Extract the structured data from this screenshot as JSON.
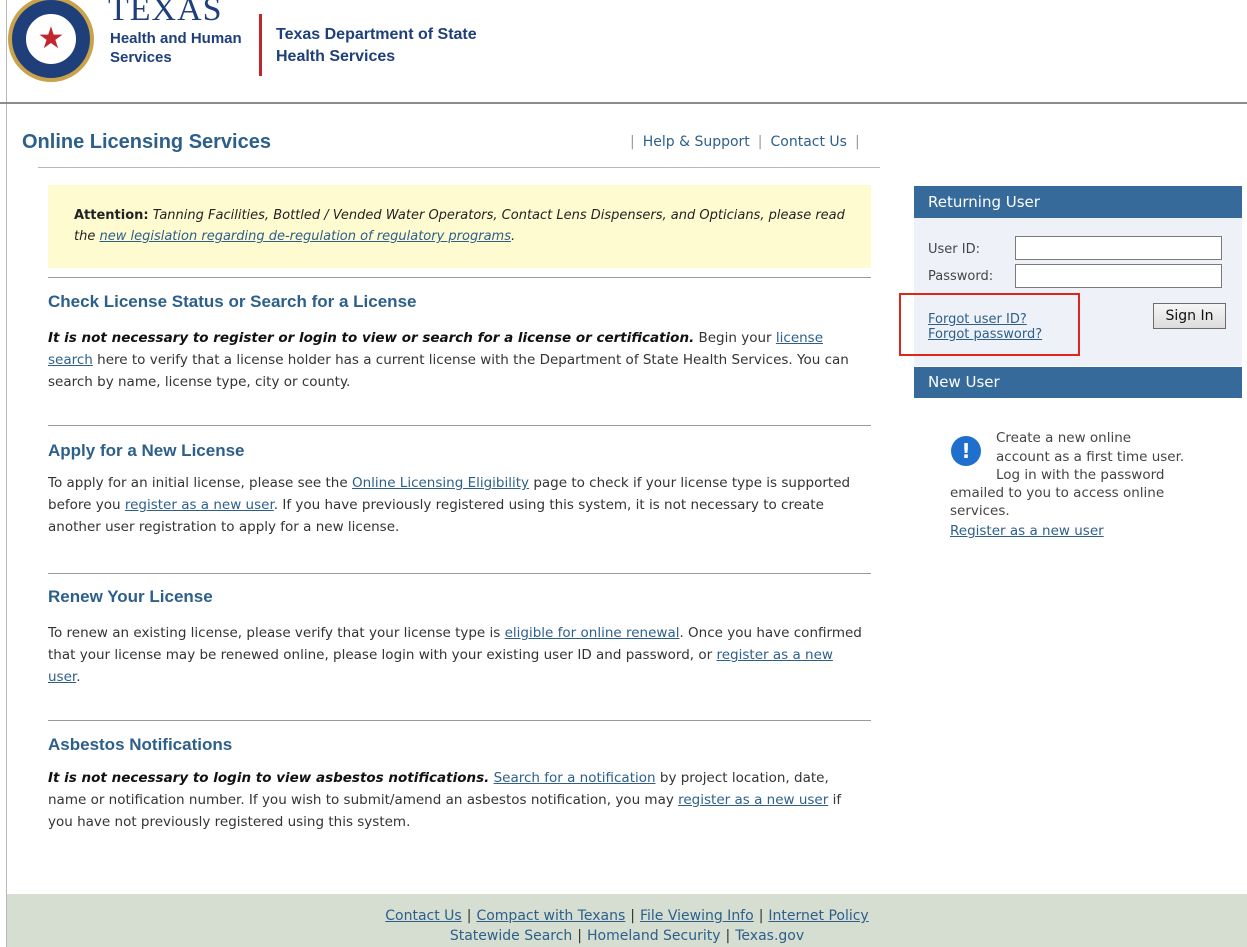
{
  "header": {
    "texas": "TEXAS",
    "hhs_line1": "Health and Human",
    "hhs_line2": "Services",
    "dshs_line1": "Texas Department of State",
    "dshs_line2": "Health Services"
  },
  "title": "Online Licensing Services",
  "top_links": [
    "Help & Support",
    "Contact Us"
  ],
  "attention": {
    "label": "Attention:",
    "text": "Tanning Facilities, Bottled / Vended Water Operators, Contact Lens Dispensers, and Opticians, please read the",
    "link": "new legislation regarding de-regulation of regulatory programs",
    "end": "."
  },
  "sections": {
    "check": {
      "title": "Check License Status or Search for a License",
      "bold": "It is not necessary to register or login to view or search for a license or certification.",
      "t1": " Begin your ",
      "link1": "license search",
      "t2": " here to verify that a license holder has a current license with the Department of State Health Services. You can search by name, license type, city or county."
    },
    "apply": {
      "title": "Apply for a New License",
      "t1": "To apply for an initial license, please see the ",
      "link1": "Online Licensing Eligibility",
      "t2": " page to check if your license type is supported before you ",
      "link2": "register as a new user",
      "t3": ". If you have previously registered using this system, it is not necessary to create another user registration to apply for a new license."
    },
    "renew": {
      "title": "Renew Your License",
      "t1": "To renew an existing license, please verify that your license type is ",
      "link1": "eligible for online renewal",
      "t2": ". Once you have confirmed that your license may be renewed online, please login with your existing user ID and password, or ",
      "link2": "register as a new user",
      "t3": "."
    },
    "asbestos": {
      "title": "Asbestos Notifications",
      "bold": "It is not necessary to login to view asbestos notifications.",
      "t1": " ",
      "link1": "Search for a notification",
      "t2": " by project location, date, name or notification number. If you wish to submit/amend an asbestos notification, you may ",
      "link2": "register as a new user",
      "t3": " if you have not previously registered using this system."
    }
  },
  "returning_user": {
    "header": "Returning User",
    "user_id_label": "User ID:",
    "password_label": "Password:",
    "user_id_value": "",
    "password_value": "",
    "forgot_user_id": "Forgot user ID?",
    "forgot_password": "Forgot password?",
    "sign_in": "Sign In"
  },
  "new_user": {
    "header": "New User",
    "icon": "info-icon",
    "line1": "Create a new online",
    "line2": "account as a first time user.",
    "line3": "Log in with the password",
    "line4": "emailed to you to access online",
    "line5": "services.",
    "link": "Register as a new user"
  },
  "footer": {
    "row1": [
      "Contact Us",
      "Compact with Texans",
      "File Viewing Info",
      "Internet Policy"
    ],
    "row2": [
      "Statewide Search",
      "Homeland Security",
      "Texas.gov"
    ]
  },
  "colors": {
    "accent_blue": "#2d5f8b",
    "panel_header": "#356a9b",
    "attention_bg": "#fffbd0",
    "footer_bg": "#d6ddd1",
    "highlight_red": "#e0251b"
  }
}
